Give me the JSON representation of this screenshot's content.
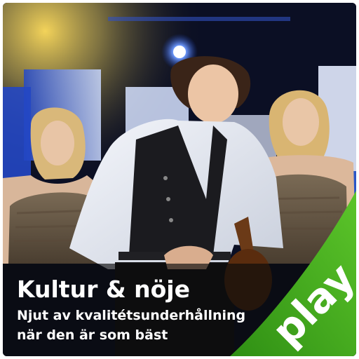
{
  "tile": {
    "title": "Kultur & nöje",
    "subtitle": "Njut av kvalitétsunderhållning när den är som bäst",
    "badge_label": "play"
  },
  "colors": {
    "ribbon_green": "#2f8f14",
    "ribbon_green_light": "#5cc52a",
    "stage_blue": "#2b5bd6",
    "caption_band": "#0a0a0c"
  },
  "icons": {
    "photo": "concert-stage-photo"
  }
}
